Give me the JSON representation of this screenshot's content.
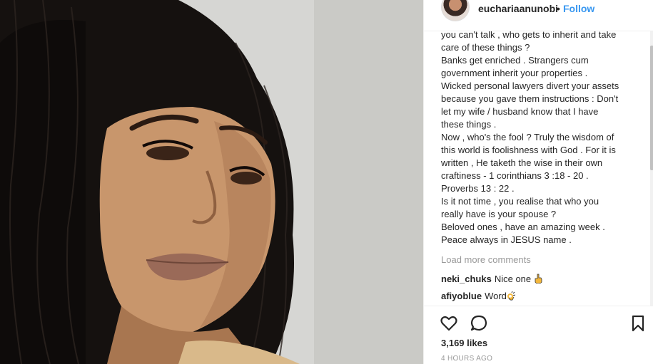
{
  "post": {
    "username": "euchariaanunobi",
    "separator": "•",
    "follow_label": "Follow",
    "caption_lines": [
      "you can't talk , who gets to inherit and take",
      "care of these things ?",
      "Banks get enriched . Strangers cum",
      "government inherit your properties .",
      "Wicked personal lawyers divert your assets",
      "because you gave them instructions : Don't",
      "let my wife / husband know that I have",
      "these things .",
      "Now , who's the fool ? Truly the wisdom of",
      "this world is foolishness with God . For it is",
      "written , He taketh the wise in their own",
      "craftiness - 1 corinthians 3 :18 - 20 .",
      "Proverbs 13 : 22 .",
      "Is it not time , you realise that who you",
      "really have is your spouse ?",
      "Beloved ones , have an amazing week .",
      "Peace always in JESUS name ."
    ],
    "load_more": "Load more comments",
    "comments": [
      {
        "user": "neki_chuks",
        "text": "Nice one"
      },
      {
        "user": "afiyoblue",
        "text": "Word"
      }
    ],
    "likes": "3,169 likes",
    "timestamp": "4 HOURS AGO"
  },
  "icons": {
    "like": "heart-icon",
    "comment": "speech-bubble-icon",
    "save": "bookmark-icon",
    "comment_emoji_1": "pointing-hand-emoji",
    "comment_emoji_2": "ok-hand-emoji"
  },
  "colors": {
    "follow_blue": "#3897f0",
    "secondary_text": "#999999"
  }
}
